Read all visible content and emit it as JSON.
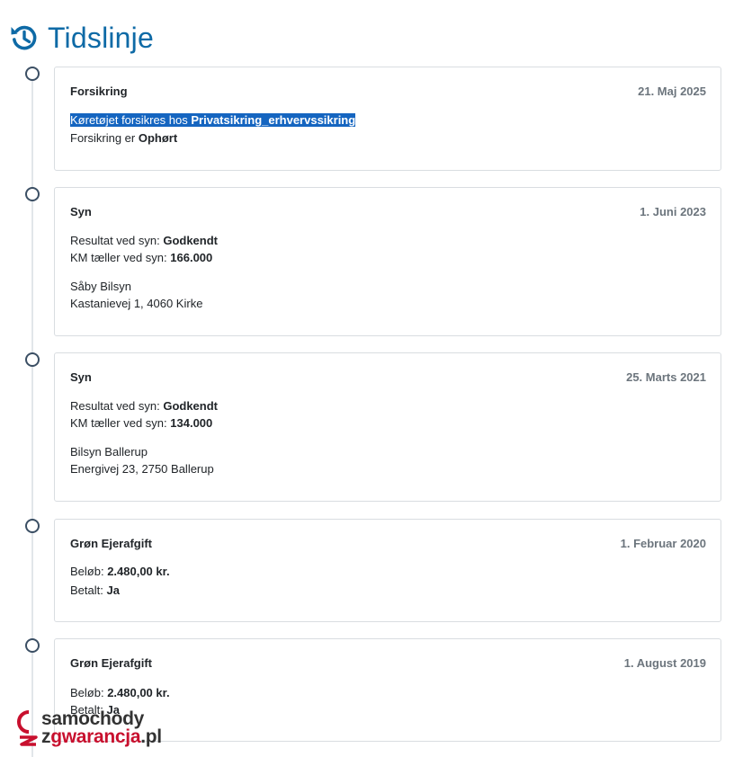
{
  "header": {
    "title": "Tidslinje",
    "icon": "history-icon",
    "accent": "#0e6aa6"
  },
  "timeline": [
    {
      "title": "Forsikring",
      "date": "21. Maj 2025",
      "lines": [
        {
          "label": "Køretøjet forsikres hos ",
          "value": "Privatsikring_erhvervssikring",
          "selected": true
        },
        {
          "label": "Forsikring er ",
          "value": "Ophørt"
        }
      ]
    },
    {
      "title": "Syn",
      "date": "1. Juni 2023",
      "lines": [
        {
          "label": "Resultat ved syn: ",
          "value": "Godkendt"
        },
        {
          "label": "KM tæller ved syn: ",
          "value": "166.000"
        }
      ],
      "address": [
        "Såby Bilsyn",
        "Kastanievej 1, 4060 Kirke"
      ]
    },
    {
      "title": "Syn",
      "date": "25. Marts 2021",
      "lines": [
        {
          "label": "Resultat ved syn: ",
          "value": "Godkendt"
        },
        {
          "label": "KM tæller ved syn: ",
          "value": "134.000"
        }
      ],
      "address": [
        "Bilsyn Ballerup",
        "Energivej 23, 2750 Ballerup"
      ]
    },
    {
      "title": "Grøn Ejerafgift",
      "date": "1. Februar 2020",
      "lines": [
        {
          "label": "Beløb: ",
          "value": "2.480,00 kr."
        },
        {
          "label": "Betalt: ",
          "value": "Ja"
        }
      ]
    },
    {
      "title": "Grøn Ejerafgift",
      "date": "1. August 2019",
      "lines": [
        {
          "label": "Beløb: ",
          "value": "2.480,00 kr."
        },
        {
          "label": "Betalt: ",
          "value": "Ja"
        }
      ]
    }
  ],
  "watermark": {
    "line1": "samochody",
    "line2_prefix": "z",
    "line2_red": "gwarancja",
    "line2_suffix": ".pl"
  }
}
